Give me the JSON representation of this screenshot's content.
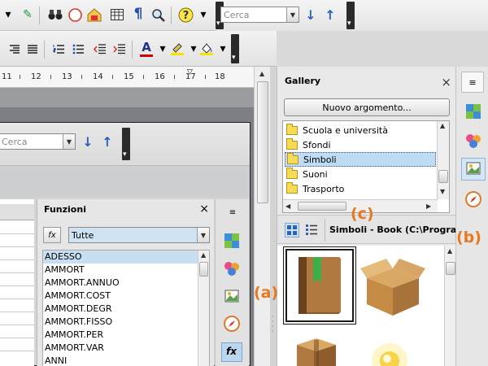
{
  "toolbar": {
    "search_value": "",
    "search_placeholder": "Cerca",
    "pilcrow": "¶",
    "help": "?",
    "font_color": "A"
  },
  "ruler": {
    "numbers": [
      "11",
      "12",
      "13",
      "14",
      "15",
      "16",
      "17",
      "18"
    ]
  },
  "inner_window": {
    "search_placeholder": "Cerca"
  },
  "functions_panel": {
    "title": "Funzioni",
    "close": "×",
    "fx_label": "fx",
    "category": "Tutte",
    "items": [
      "ADESSO",
      "AMMORT",
      "AMMORT.ANNUO",
      "AMMORT.COST",
      "AMMORT.DEGR",
      "AMMORT.FISSO",
      "AMMORT.PER",
      "AMMORT.VAR",
      "ANNI"
    ],
    "selected_index": 0
  },
  "gallery": {
    "title": "Gallery",
    "close": "×",
    "new_theme_button": "Nuovo argomento...",
    "themes": [
      "Scuola e università",
      "Sfondi",
      "Simboli",
      "Suoni",
      "Trasporto"
    ],
    "selected_theme_index": 2,
    "current_path": "Simboli - Book (C:\\Program"
  },
  "callouts": {
    "a": "(a)",
    "b": "(b)",
    "c": "(c)"
  },
  "colors": {
    "accent_orange": "#e8781d",
    "selection_blue": "#bfdcf5",
    "folder_yellow": "#f6dc55"
  },
  "icons": [
    "pencil-icon",
    "binoculars-icon",
    "navigator-icon",
    "image-icon",
    "table-icon",
    "pilcrow-icon",
    "zoom-icon",
    "help-icon",
    "arrow-down-icon",
    "arrow-up-icon",
    "font-color-icon",
    "highlight-icon",
    "background-color-icon",
    "properties-icon",
    "styles-icon",
    "gallery-icon",
    "book-icon",
    "box-icon"
  ]
}
